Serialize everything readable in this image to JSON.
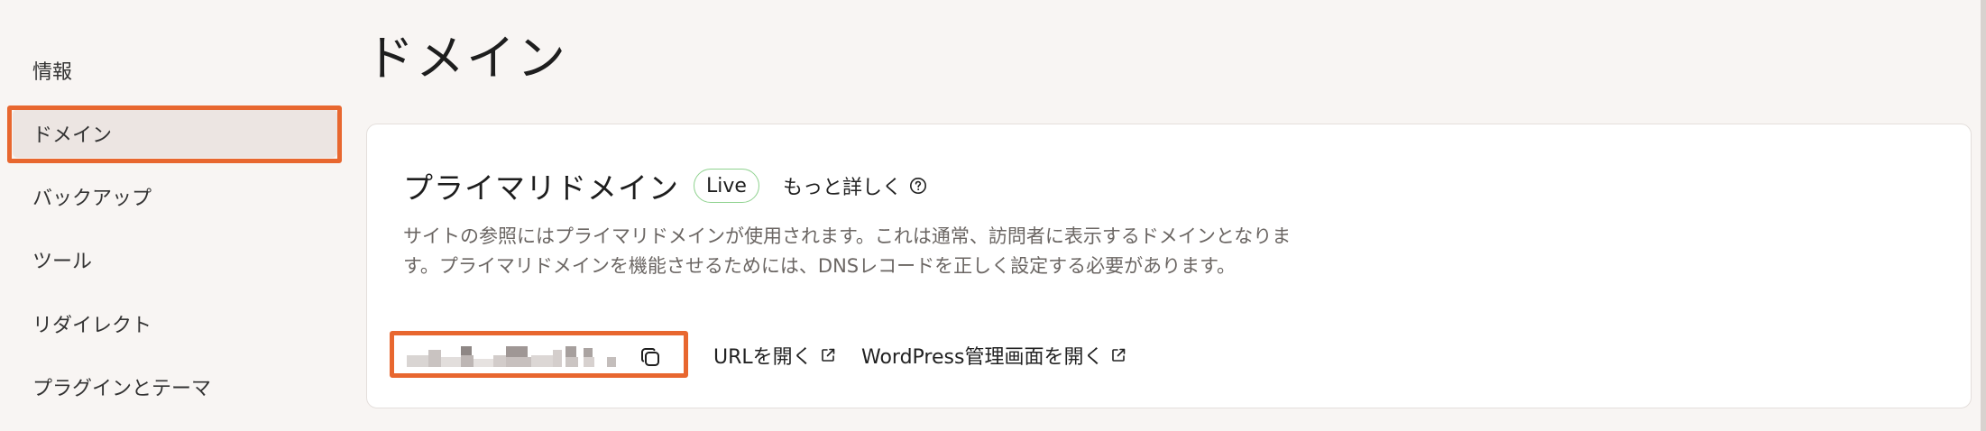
{
  "sidebar": {
    "items": [
      {
        "label": "情報"
      },
      {
        "label": "ドメイン",
        "active": true
      },
      {
        "label": "バックアップ"
      },
      {
        "label": "ツール"
      },
      {
        "label": "リダイレクト"
      },
      {
        "label": "プラグインとテーマ"
      }
    ]
  },
  "page": {
    "title": "ドメイン"
  },
  "primary_domain": {
    "title": "プライマリドメイン",
    "status_badge": "Live",
    "learn_more": "もっと詳しく",
    "description": "サイトの参照にはプライマリドメインが使用されます。これは通常、訪問者に表示するドメインとなります。プライマリドメインを機能させるためには、DNSレコードを正しく設定する必要があります。",
    "open_url_label": "URLを開く",
    "open_wp_admin_label": "WordPress管理画面を開く"
  },
  "icons": {
    "help": "help-circle-icon",
    "external": "external-link-icon",
    "copy": "copy-icon"
  },
  "colors": {
    "highlight": "#e8672f",
    "live_border": "#8fd28f",
    "background": "#f8f5f3",
    "active_item": "#ece5e2"
  }
}
